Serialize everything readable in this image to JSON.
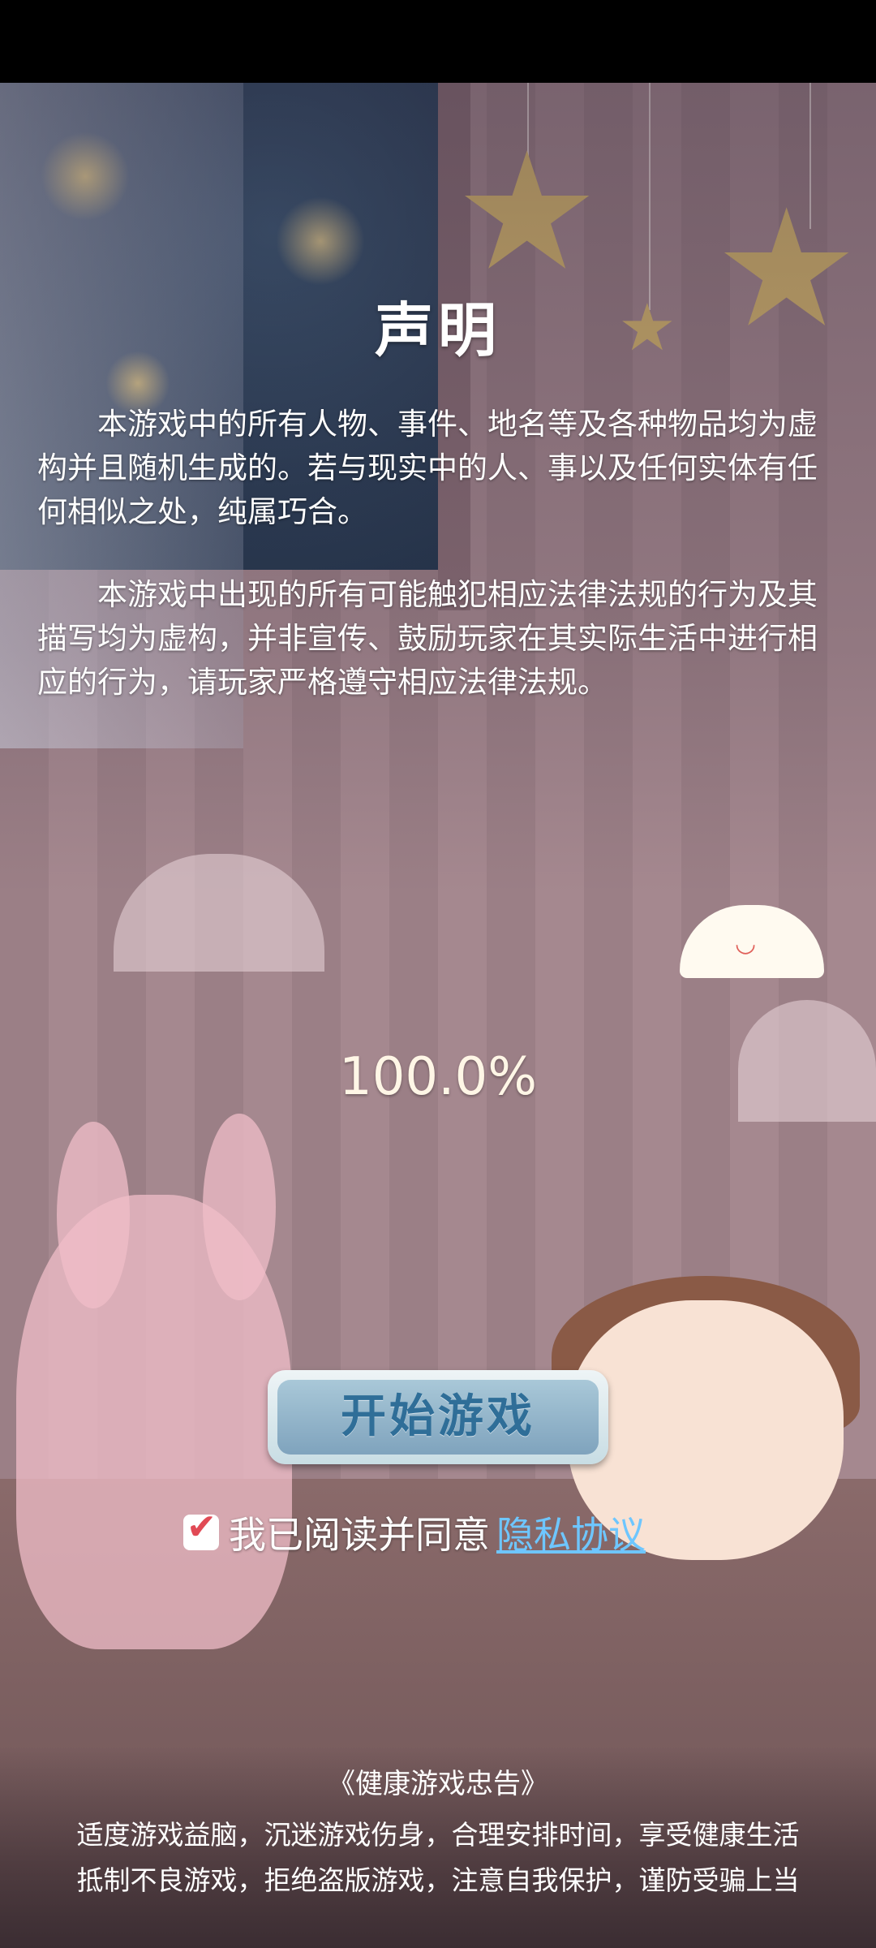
{
  "declaration": {
    "title": "声明",
    "paragraphs": [
      "本游戏中的所有人物、事件、地名等及各种物品均为虚构并且随机生成的。若与现实中的人、事以及任何实体有任何相似之处，纯属巧合。",
      "本游戏中出现的所有可能触犯相应法律法规的行为及其描写均为虚构，并非宣传、鼓励玩家在其实际生活中进行相应的行为，请玩家严格遵守相应法律法规。"
    ]
  },
  "loading": {
    "progress_text": "100.0%",
    "progress_value": 100.0
  },
  "start_button": {
    "label": "开始游戏"
  },
  "agreement": {
    "checked": true,
    "text": "我已阅读并同意",
    "link_label": "隐私协议"
  },
  "health_advice": {
    "title": "《健康游戏忠告》",
    "lines": [
      "适度游戏益脑，沉迷游戏伤身，合理安排时间，享受健康生活",
      "抵制不良游戏，拒绝盗版游戏，注意自我保护，谨防受骗上当"
    ]
  },
  "icons": {
    "checkbox": "check-icon",
    "mascot": "cloud-mascot-icon",
    "stars": "star-icon"
  },
  "colors": {
    "link": "#6ec6ff",
    "check": "#e14a55",
    "button_text": "#2f6e98"
  }
}
